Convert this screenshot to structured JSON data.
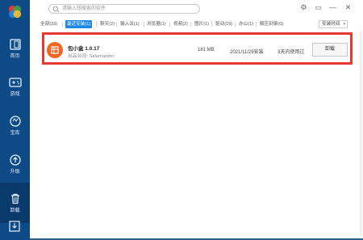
{
  "window": {
    "controls": [
      "⚙",
      "▭",
      "—",
      "✕"
    ]
  },
  "search": {
    "placeholder": "请输入想搜索的软件"
  },
  "sidebar": {
    "items": [
      {
        "label": "首页",
        "icon": "home-icon"
      },
      {
        "label": "游戏",
        "icon": "gamepad-icon"
      },
      {
        "label": "宝库",
        "icon": "treasure-icon"
      },
      {
        "label": "升级",
        "icon": "upgrade-icon"
      },
      {
        "label": "卸载",
        "icon": "trash-icon",
        "active": true
      }
    ],
    "bottom_icon": "download-icon"
  },
  "tabs": [
    {
      "label": "全部(33)"
    },
    {
      "label": "最近安装(1)",
      "active": true
    },
    {
      "label": "聊天(2)"
    },
    {
      "label": "输入法(1)"
    },
    {
      "label": "浏览器(1)"
    },
    {
      "label": "视频(2)"
    },
    {
      "label": "图片(1)"
    },
    {
      "label": "驱动(19)"
    },
    {
      "label": "办公(1)"
    },
    {
      "label": "解压刻录(0)"
    }
  ],
  "sort": {
    "label": "安装时间"
  },
  "apps": [
    {
      "name": "包小盒 1.0.17",
      "publisher": "出品公司: Salamander",
      "size": "181 MB",
      "install_date": "2021/11/29安装",
      "usage": "3天内使用过",
      "action": "卸载"
    }
  ],
  "colors": {
    "sidebar": "#0d4a86",
    "accent": "#1e88e5",
    "highlight": "#e53935",
    "app_icon": "#f26522"
  }
}
